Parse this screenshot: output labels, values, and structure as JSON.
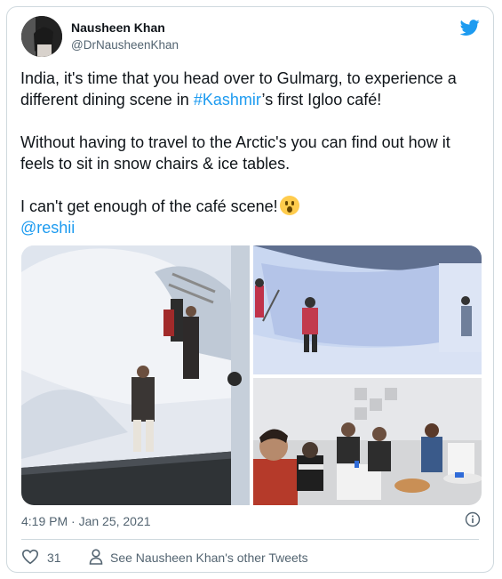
{
  "tweet": {
    "author_name": "Nausheen Khan",
    "author_handle": "@DrNausheenKhan",
    "para1_a": "India, it's time that you head over to Gulmarg, to experience a different dining scene in ",
    "para1_hashtag": "#Kashmir",
    "para1_b": "’s first Igloo café!",
    "para2": "Without having to travel to the Arctic's you can find out how it feels to sit in snow chairs & ice tables.",
    "para3": "I can't get enough of the café scene!",
    "emoji_icon": "hushed-face-emoji",
    "mention": "@reshii",
    "timestamp": "4:19 PM · Jan 25, 2021",
    "likes": "31",
    "other_tweets": "See Nausheen Khan's other Tweets"
  },
  "colors": {
    "link": "#1d9bf0",
    "twitter_blue": "#1d9bf0",
    "muted": "#536471",
    "border": "#cfd9de"
  },
  "icons": {
    "brand": "twitter-bird-icon",
    "info": "info-icon",
    "like": "heart-icon",
    "profile": "person-icon"
  }
}
